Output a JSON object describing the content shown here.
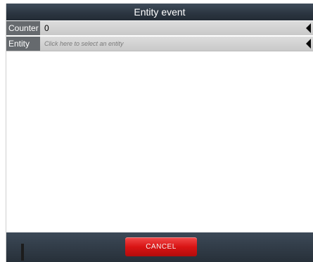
{
  "dialog": {
    "title": "Entity event"
  },
  "fields": {
    "counter": {
      "label": "Counter",
      "value": "0"
    },
    "entity": {
      "label": "Entity",
      "placeholder": "Click here to select an entity"
    }
  },
  "footer": {
    "cancel_label": "CANCEL"
  },
  "colors": {
    "title_bar": "#2b3540",
    "label_bg": "#666a6e",
    "value_bg": "#d4d4d4",
    "cancel_button": "#d91414"
  },
  "icons": {
    "dropdown_arrow": "left-triangle-icon"
  }
}
